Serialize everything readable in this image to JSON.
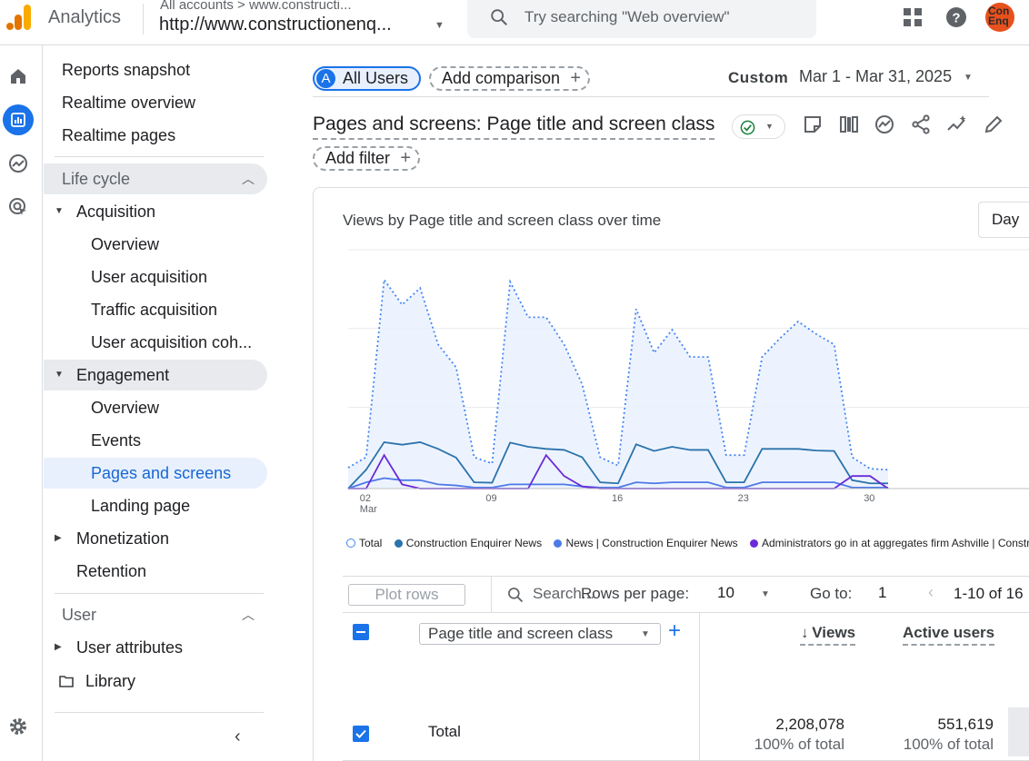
{
  "header": {
    "app_name": "Analytics",
    "account_path": "All accounts > www.constructi...",
    "property": "http://www.constructionenq...",
    "search_placeholder": "Try searching \"Web overview\"",
    "avatar_text": "Con Enq"
  },
  "sidebar": {
    "top_items": [
      "Reports snapshot",
      "Realtime overview",
      "Realtime pages"
    ],
    "lifecycle_label": "Life cycle",
    "acquisition": {
      "label": "Acquisition",
      "items": [
        "Overview",
        "User acquisition",
        "Traffic acquisition",
        "User acquisition coh..."
      ]
    },
    "engagement": {
      "label": "Engagement",
      "items": [
        "Overview",
        "Events",
        "Pages and screens",
        "Landing page"
      ]
    },
    "monetization": "Monetization",
    "retention": "Retention",
    "user_label": "User",
    "user_attributes": "User attributes",
    "library": "Library"
  },
  "toolbar": {
    "all_users": "All Users",
    "all_users_badge": "A",
    "add_comparison": "Add comparison",
    "custom_label": "Custom",
    "date_range": "Mar 1 - Mar 31, 2025",
    "report_title": "Pages and screens: Page title and screen class",
    "add_filter": "Add filter"
  },
  "chart": {
    "title": "Views by Page title and screen class over time",
    "granularity": "Day",
    "legend": [
      "Total",
      "Construction Enquirer News",
      "News | Construction Enquirer News",
      "Administrators go in at aggregates firm Ashville | Constr"
    ]
  },
  "chart_data": {
    "type": "line",
    "x_ticks": [
      {
        "day": 2,
        "label": "02",
        "sub": "Mar"
      },
      {
        "day": 9,
        "label": "09",
        "sub": ""
      },
      {
        "day": 16,
        "label": "16",
        "sub": ""
      },
      {
        "day": 23,
        "label": "23",
        "sub": ""
      },
      {
        "day": 30,
        "label": "30",
        "sub": ""
      }
    ],
    "x": [
      1,
      2,
      3,
      4,
      5,
      6,
      7,
      8,
      9,
      10,
      11,
      12,
      13,
      14,
      15,
      16,
      17,
      18,
      19,
      20,
      21,
      22,
      23,
      24,
      25,
      26,
      27,
      28,
      29,
      30,
      31
    ],
    "series": [
      {
        "name": "Total",
        "color": "#4285f4",
        "dotted": true,
        "values": [
          100,
          150,
          1000,
          880,
          960,
          690,
          580,
          150,
          120,
          990,
          820,
          820,
          690,
          500,
          150,
          110,
          860,
          650,
          760,
          630,
          630,
          160,
          160,
          630,
          720,
          800,
          740,
          690,
          150,
          95,
          90
        ]
      },
      {
        "name": "Construction Enquirer News",
        "color": "#2a73ab",
        "values": [
          0,
          90,
          222,
          210,
          222,
          190,
          148,
          30,
          28,
          220,
          200,
          190,
          185,
          150,
          30,
          25,
          212,
          180,
          200,
          185,
          185,
          30,
          30,
          190,
          190,
          190,
          182,
          180,
          40,
          25,
          25
        ]
      },
      {
        "name": "News | Construction Enquirer News",
        "color": "#4d79e8",
        "values": [
          0,
          30,
          50,
          40,
          40,
          20,
          15,
          5,
          5,
          20,
          20,
          20,
          20,
          10,
          5,
          5,
          30,
          25,
          30,
          30,
          30,
          5,
          5,
          30,
          30,
          30,
          30,
          30,
          5,
          5,
          5
        ]
      },
      {
        "name": "Administrators go in at aggregates firm Ashville | Constr",
        "color": "#6a2bd8",
        "values": [
          0,
          0,
          160,
          20,
          0,
          0,
          0,
          0,
          0,
          0,
          0,
          160,
          60,
          10,
          0,
          0,
          0,
          0,
          0,
          0,
          0,
          0,
          0,
          0,
          0,
          0,
          0,
          0,
          60,
          60,
          0
        ]
      }
    ]
  },
  "table": {
    "plot_rows": "Plot rows",
    "search_placeholder": "Search...",
    "rows_per_page_label": "Rows per page:",
    "rows_per_page": "10",
    "goto_label": "Go to:",
    "goto_value": "1",
    "pager": "1-10 of 16",
    "dimension": "Page title and screen class",
    "col_views": "Views",
    "col_active_users": "Active users",
    "total_label": "Total",
    "total_views": "2,208,078",
    "total_views_pct": "100% of total",
    "total_users": "551,619",
    "total_users_pct": "100% of total"
  }
}
